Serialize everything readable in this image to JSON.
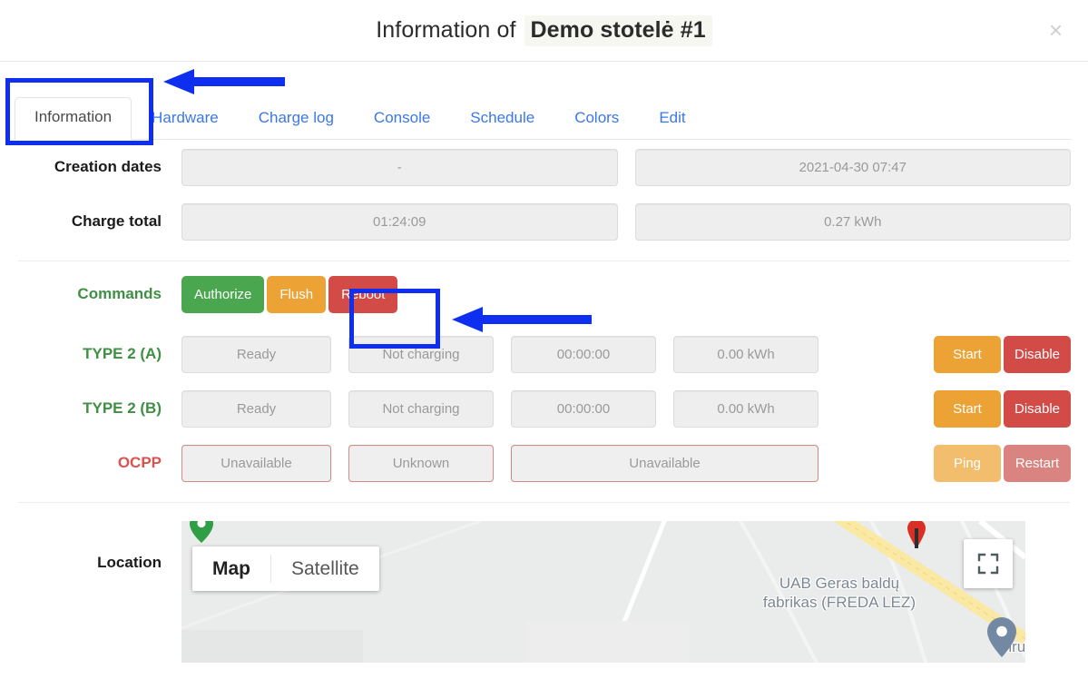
{
  "header": {
    "title_prefix": "Information of",
    "title_name": "Demo stotelė #1",
    "close_label": "×"
  },
  "tabs": [
    {
      "label": "Information",
      "active": true
    },
    {
      "label": "Hardware",
      "active": false
    },
    {
      "label": "Charge log",
      "active": false
    },
    {
      "label": "Console",
      "active": false
    },
    {
      "label": "Schedule",
      "active": false
    },
    {
      "label": "Colors",
      "active": false
    },
    {
      "label": "Edit",
      "active": false
    }
  ],
  "info": {
    "creation_dates": {
      "label": "Creation dates",
      "left_value": "-",
      "right_value": "2021-04-30 07:47"
    },
    "charge_total": {
      "label": "Charge total",
      "left_value": "01:24:09",
      "right_value": "0.27 kWh"
    }
  },
  "commands": {
    "label": "Commands",
    "buttons": [
      {
        "label": "Authorize",
        "color": "#4ba74f"
      },
      {
        "label": "Flush",
        "color": "#eda236"
      },
      {
        "label": "Reboot",
        "color": "#d34b47"
      }
    ]
  },
  "connectors": [
    {
      "label": "TYPE 2 (A)",
      "status": "Ready",
      "charging": "Not charging",
      "duration": "00:00:00",
      "energy": "0.00 kWh",
      "start_label": "Start",
      "disable_label": "Disable"
    },
    {
      "label": "TYPE 2 (B)",
      "status": "Ready",
      "charging": "Not charging",
      "duration": "00:00:00",
      "energy": "0.00 kWh",
      "start_label": "Start",
      "disable_label": "Disable"
    }
  ],
  "ocpp": {
    "label": "OCPP",
    "status": "Unavailable",
    "state": "Unknown",
    "detail": "Unavailable",
    "ping_label": "Ping",
    "restart_label": "Restart"
  },
  "location": {
    "label": "Location",
    "map_button": "Map",
    "satellite_button": "Satellite",
    "poi_label": "UAB Geras baldų\nfabrikas (FREDA LEZ)",
    "area_label": "Biruliškės",
    "fullscreen_icon": "fullscreen-icon"
  },
  "annotations": {
    "accent_color": "#0e2ef0",
    "highlight_tab": "Information",
    "highlight_button": "Reboot"
  }
}
